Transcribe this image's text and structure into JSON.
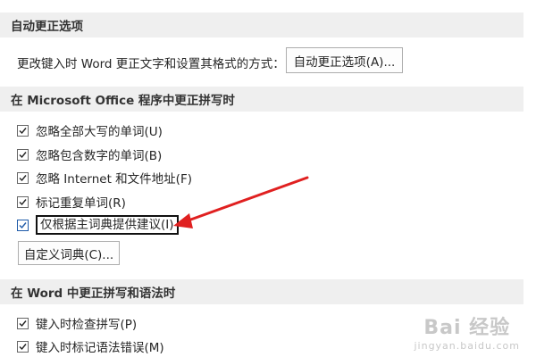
{
  "autocorrect": {
    "header": "自动更正选项",
    "description": "更改键入时 Word 更正文字和设置其格式的方式：",
    "button_label": "自动更正选项(A)..."
  },
  "office_spelling": {
    "header": "在 Microsoft Office 程序中更正拼写时",
    "options": [
      {
        "label": "忽略全部大写的单词(U)",
        "checked": true
      },
      {
        "label": "忽略包含数字的单词(B)",
        "checked": true
      },
      {
        "label": "忽略 Internet 和文件地址(F)",
        "checked": true
      },
      {
        "label": "标记重复单词(R)",
        "checked": true
      },
      {
        "label": "仅根据主词典提供建议(I)",
        "checked": true
      }
    ],
    "custom_dict_button": "自定义词典(C)..."
  },
  "word_spelling": {
    "header": "在 Word 中更正拼写和语法时",
    "options": [
      {
        "label": "键入时检查拼写(P)",
        "checked": true
      },
      {
        "label": "键入时标记语法错误(M)",
        "checked": true
      }
    ]
  },
  "annotation": {
    "arrow_color": "#e02020",
    "highlight_color": "#111111"
  },
  "watermark": {
    "top": "Bai 经验",
    "bottom": "jingyan.baidu.com"
  }
}
